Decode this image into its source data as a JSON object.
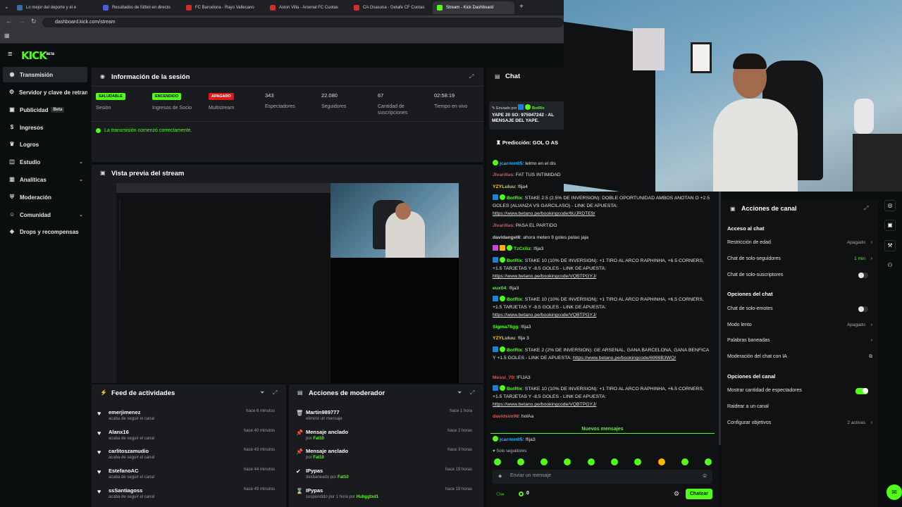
{
  "browser": {
    "tabs": [
      {
        "label": "Lo mejor del deporte y el e",
        "color": "#3a6ea5"
      },
      {
        "label": "Resultados de fútbol en directo",
        "color": "#4a5ee0"
      },
      {
        "label": "FC Barcelona - Rayo Vallecano",
        "color": "#d62b2b"
      },
      {
        "label": "Aston Villa - Arsenal FC Cuotas",
        "color": "#d62b2b"
      },
      {
        "label": "CA Osasuna - Getafe CF Cuotas",
        "color": "#d62b2b"
      },
      {
        "label": "Stream - Kick Dashboard",
        "color": "#53fc18"
      }
    ],
    "url": "dashboard.kick.com/stream"
  },
  "kick": {
    "logo": "KICK",
    "logo_sup": "BETA"
  },
  "sidebar": {
    "items": [
      {
        "label": "Transmisión",
        "icon": "broadcast-icon"
      },
      {
        "label": "Servidor y clave de retransmisión",
        "icon": "server-icon"
      },
      {
        "label": "Publicidad",
        "icon": "ads-icon",
        "badge": "Beta"
      },
      {
        "label": "Ingresos",
        "icon": "money-icon"
      },
      {
        "label": "Logros",
        "icon": "trophy-icon"
      },
      {
        "label": "Estudio",
        "icon": "studio-icon"
      },
      {
        "label": "Analíticas",
        "icon": "chart-icon"
      },
      {
        "label": "Moderación",
        "icon": "shield-icon"
      },
      {
        "label": "Comunidad",
        "icon": "people-icon"
      },
      {
        "label": "Drops y recompensas",
        "icon": "gift-icon"
      }
    ]
  },
  "session": {
    "title": "Información de la sesión",
    "stats": [
      {
        "badge": "SALUDABLE",
        "label": "Sesión"
      },
      {
        "badge": "ENCENDIDO",
        "label": "Ingresos de Socio"
      },
      {
        "badge": "APAGADO",
        "label": "Multistream"
      },
      {
        "value": "343",
        "label": "Espectadores"
      },
      {
        "value": "22.080",
        "label": "Seguidores"
      },
      {
        "value": "67",
        "label": "Cantidad de suscripciones"
      },
      {
        "value": "02:58:19",
        "label": "Tiempo en vivo"
      }
    ],
    "status": "La transmisión comenzó correctamente."
  },
  "preview": {
    "title": "Vista previa del stream"
  },
  "feed": {
    "title": "Feed de actividades",
    "items": [
      {
        "name": "emerjimenez",
        "sub": "acaba de seguir el canal",
        "time": "hace 6 minutos"
      },
      {
        "name": "Alanx16",
        "sub": "acaba de seguir el canal",
        "time": "hace 40 minutos"
      },
      {
        "name": "carlitoszamudio",
        "sub": "acaba de seguir el canal",
        "time": "hace 43 minutos"
      },
      {
        "name": "EstefanoAC",
        "sub": "acaba de seguir el canal",
        "time": "hace 44 minutos"
      },
      {
        "name": "ssSantiagoss",
        "sub": "acaba de seguir el canal",
        "time": "hace 49 minutos"
      }
    ]
  },
  "mod": {
    "title": "Acciones de moderador",
    "items": [
      {
        "name": "Martin989777",
        "sub": "eliminó un mensaje",
        "by": "",
        "time": "hace 1 hora"
      },
      {
        "name": "Mensaje anclado",
        "sub": "por",
        "by": "Fat10",
        "time": "hace 2 horas"
      },
      {
        "name": "Mensaje anclado",
        "sub": "por",
        "by": "Fat10",
        "time": "hace 3 horas"
      },
      {
        "name": "IPypas",
        "sub": "desbaneado por",
        "by": "Fat10",
        "time": "hace 19 horas"
      },
      {
        "name": "IPypas",
        "sub": "suspendido por 1 hora por",
        "by": "Huhggtxd1",
        "time": "hace 19 horas"
      }
    ]
  },
  "chat": {
    "title": "Chat",
    "pinned_by_label": "Enviado por",
    "pinned_by": "BotRix",
    "pinned_text": "YAPE 20 SO: 975947242 - AL MENSAJE DEL YAPE.",
    "prediction": "Predicción: GOL O AS",
    "messages": [
      {
        "user": "jcarrion05",
        "color": "#1fb8ff",
        "text": "lelmo en el dis"
      },
      {
        "user": "Jlvarillas",
        "color": "#ff4a4a",
        "text": "FAT TUS INTIMIDAD"
      },
      {
        "user": "YZYLuluu",
        "color": "#ffd000",
        "text": "!fija4"
      },
      {
        "user": "BotRix",
        "color": "#53fc18",
        "text": "STAKE 2.5 (2.5% DE INVERSION): DOBLE OPORTUNIDAD AMBOS ANOTAN O +2.5 GOLES (ALIANZA VS GARCILASO) - LINK DE APUESTA:",
        "link": "https://www.betano.pe/bookingcode/6UJRDTE9/"
      },
      {
        "user": "Jlvarillas",
        "color": "#ff4a4a",
        "text": "PASA EL PARTIDO"
      },
      {
        "user": "davidangel8",
        "color": "#cfcfcf",
        "text": "ahora meten 9 goles pelao jaja"
      },
      {
        "user": "TzCriliz",
        "color": "#53fc18",
        "text": "!fija3"
      },
      {
        "user": "BotRix",
        "color": "#53fc18",
        "text": "STAKE 10 (10% DE INVERSION): +1 TIRO AL ARCO RAPHINHA, +6.5 CORNERS, +1.5 TARJETAS Y -8.5 GOLES - LINK DE APUESTA:",
        "link": "https://www.betano.pe/bookingcode/VQBTPGYJ/"
      },
      {
        "user": "eux04",
        "color": "#53fc18",
        "text": "!fija3"
      },
      {
        "user": "BotRix",
        "color": "#53fc18",
        "text": "STAKE 10 (10% DE INVERSION): +1 TIRO AL ARCO RAPHINHA, +6.5 CORNERS, +1.5 TARJETAS Y -8.5 GOLES - LINK DE APUESTA:",
        "link": "https://www.betano.pe/bookingcode/VQBTPGYJ/"
      },
      {
        "user": "Sigma78gg",
        "color": "#53fc18",
        "text": "!fija3"
      },
      {
        "user": "YZYLuluu",
        "color": "#ffd000",
        "text": "!fija 3"
      },
      {
        "user": "BotRix",
        "color": "#53fc18",
        "text": "STAKE 2 (2% DE INVERSION): GE ARSENAL, GANA BARCELONA, GANA BENFICA Y +1.5 GOLES - LINK DE APUESTA:",
        "link": "https://www.betano.pe/bookingcode/6998B3WQ/"
      },
      {
        "user": "Messi_70",
        "color": "#ff4a4a",
        "text": "!FIJA3"
      },
      {
        "user": "BotRix",
        "color": "#53fc18",
        "text": "STAKE 10 (10% DE INVERSION): +1 TIRO AL ARCO RAPHINHA, +6.5 CORNERS, +1.5 TARJETAS Y -8.5 GOLES - LINK DE APUESTA:",
        "link": "https://www.betano.pe/bookingcode/VQBTPGYJ/"
      },
      {
        "user": "davidsim98",
        "color": "#ff4a4a",
        "text": "holAa"
      }
    ],
    "new_messages": "Nuevos mensajes",
    "last": {
      "user": "jcarrion05",
      "color": "#1fb8ff",
      "text": "!fija3"
    },
    "followers_only": "Solo seguidores",
    "placeholder": "Enviar un mensaje",
    "points": "0",
    "send": "Chatear"
  },
  "channel": {
    "title": "Acciones de canal",
    "sections": [
      {
        "head": "Acceso al chat",
        "rows": [
          {
            "label": "Restricción de edad",
            "value": "Apagado",
            "kind": "arrow"
          },
          {
            "label": "Chat de solo-seguidores",
            "value": "1 min",
            "kind": "arrow",
            "green": true
          },
          {
            "label": "Chat de solo-suscriptores",
            "value": "",
            "kind": "toggle-off"
          }
        ]
      },
      {
        "head": "Opciones del chat",
        "rows": [
          {
            "label": "Chat de solo-emotes",
            "value": "",
            "kind": "toggle-off"
          },
          {
            "label": "Modo lento",
            "value": "Apagado",
            "kind": "arrow"
          },
          {
            "label": "Palabras baneadas",
            "value": "",
            "kind": "arrow"
          },
          {
            "label": "Moderación del chat con IA",
            "value": "",
            "kind": "external"
          }
        ]
      },
      {
        "head": "Opciones del canal",
        "rows": [
          {
            "label": "Mostrar cantidad de espectadores",
            "value": "",
            "kind": "toggle-on"
          },
          {
            "label": "Raidear a un canal",
            "value": "",
            "kind": "none"
          },
          {
            "label": "Configurar objetivos",
            "value": "2 activas",
            "kind": "arrow"
          }
        ]
      }
    ]
  },
  "colors": {
    "accent": "#53fc18",
    "bg": "#0b0e0f",
    "panel": "#191b1f"
  }
}
